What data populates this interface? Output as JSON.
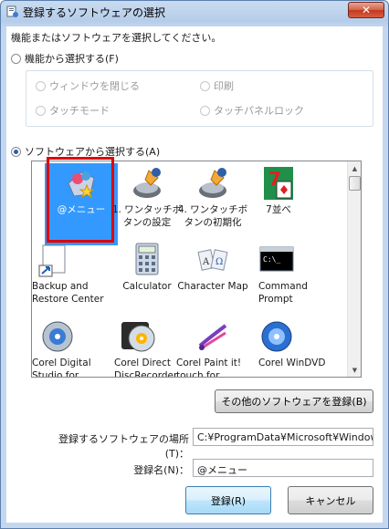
{
  "window": {
    "title": "登録するソフトウェアの選択"
  },
  "instruction": "機能またはソフトウェアを選択してください。",
  "function_option": {
    "label": "機能から選択する(F)",
    "checked": false
  },
  "function_choices": [
    {
      "label": "ウィンドウを閉じる"
    },
    {
      "label": "印刷"
    },
    {
      "label": "タッチモード"
    },
    {
      "label": "タッチパネルロック"
    }
  ],
  "software_option": {
    "label": "ソフトウェアから選択する(A)",
    "checked": true
  },
  "software_list": [
    {
      "label": "@メニュー",
      "icon": "at-menu-icon",
      "selected": true
    },
    {
      "label": "1. ワンタッチボタンの設定",
      "icon": "onetouch-setup-icon"
    },
    {
      "label": "4. ワンタッチボタンの初期化",
      "icon": "onetouch-reset-icon"
    },
    {
      "label": "7並べ",
      "icon": "card-game-icon"
    },
    {
      "label": "Backup and Restore Center",
      "icon": "backup-icon"
    },
    {
      "label": "Calculator",
      "icon": "calculator-icon"
    },
    {
      "label": "Character Map",
      "icon": "character-map-icon"
    },
    {
      "label": "Command Prompt",
      "icon": "command-prompt-icon"
    },
    {
      "label": "Corel Digital Studio for FUJITSU",
      "icon": "corel-digital-studio-icon"
    },
    {
      "label": "Corel Direct DiscRecorder",
      "icon": "corel-disc-recorder-icon"
    },
    {
      "label": "Corel Paint it! touch for FUJITSU",
      "icon": "corel-paint-icon"
    },
    {
      "label": "Corel WinDVD",
      "icon": "corel-windvd-icon"
    }
  ],
  "register_other_button": "その他のソフトウェアを登録(B)",
  "location": {
    "label": "登録するソフトウェアの場所(T)：",
    "value": "C:¥ProgramData¥Microsoft¥Windows¥Start"
  },
  "reg_name": {
    "label": "登録名(N)：",
    "value": "@メニュー"
  },
  "ok_button": "登録(R)",
  "cancel_button": "キャンセル",
  "colors": {
    "selection": "#3399ff",
    "highlight_frame": "#e00000",
    "title_gradient": "#b6cde9"
  }
}
